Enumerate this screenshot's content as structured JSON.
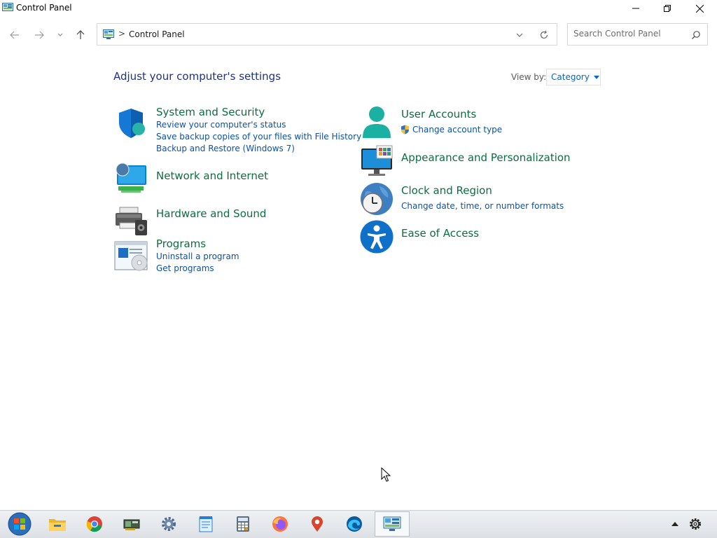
{
  "window": {
    "title": "Control Panel"
  },
  "address": {
    "crumb_separator": ">",
    "path": "Control Panel"
  },
  "search": {
    "placeholder": "Search Control Panel"
  },
  "main": {
    "title": "Adjust your computer's settings",
    "view_by_label": "View by:",
    "view_by_value": "Category"
  },
  "categories": {
    "system_security": {
      "title": "System and Security",
      "links": [
        "Review your computer's status",
        "Save backup copies of your files with File History",
        "Backup and Restore (Windows 7)"
      ]
    },
    "network": {
      "title": "Network and Internet"
    },
    "hardware": {
      "title": "Hardware and Sound"
    },
    "programs": {
      "title": "Programs",
      "links": [
        "Uninstall a program",
        "Get programs"
      ]
    },
    "user_accounts": {
      "title": "User Accounts",
      "links": [
        "Change account type"
      ]
    },
    "appearance": {
      "title": "Appearance and Personalization"
    },
    "clock_region": {
      "title": "Clock and Region",
      "links": [
        "Change date, time, or number formats"
      ]
    },
    "ease_access": {
      "title": "Ease of Access"
    }
  },
  "taskbar": {
    "items": [
      "start-orb-icon",
      "file-explorer-icon",
      "chrome-icon",
      "gpu-card-icon",
      "settings-gear-icon",
      "notepad-icon",
      "calculator-icon",
      "firefox-icon",
      "maps-pin-icon",
      "edge-icon",
      "control-panel-icon"
    ],
    "tray": [
      "show-hidden-icons-chevron",
      "tray-gear-icon"
    ]
  },
  "colors": {
    "category_title": "#0d6e3f",
    "link": "#0b52a8",
    "heading": "#1e3287"
  }
}
